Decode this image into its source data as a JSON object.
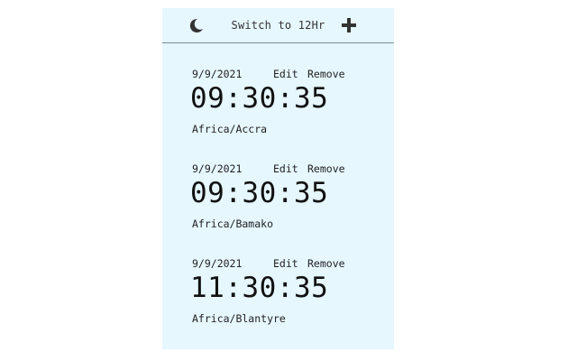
{
  "toolbar": {
    "theme_icon": "moon-icon",
    "format_toggle_label": "Switch to 12Hr",
    "add_icon": "plus-icon"
  },
  "clocks": [
    {
      "date": "9/9/2021",
      "edit_label": "Edit",
      "remove_label": "Remove",
      "time": "09:30:35",
      "timezone": "Africa/Accra"
    },
    {
      "date": "9/9/2021",
      "edit_label": "Edit",
      "remove_label": "Remove",
      "time": "09:30:35",
      "timezone": "Africa/Bamako"
    },
    {
      "date": "9/9/2021",
      "edit_label": "Edit",
      "remove_label": "Remove",
      "time": "11:30:35",
      "timezone": "Africa/Blantyre"
    }
  ],
  "colors": {
    "panel_background": "#e6f7fe",
    "toolbar_divider": "#7d8c94",
    "icon": "#333333"
  }
}
